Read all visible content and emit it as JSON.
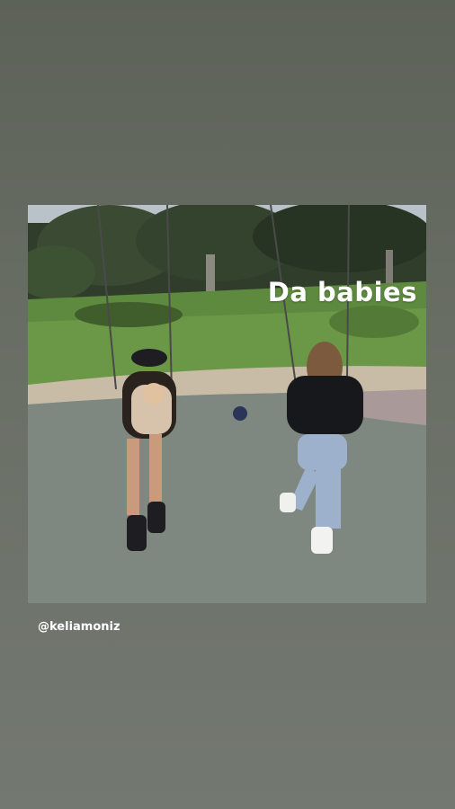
{
  "story": {
    "caption": "Da babies",
    "mention": "@keliamoniz"
  },
  "colors": {
    "background": "#63685f",
    "text": "#ffffff"
  }
}
